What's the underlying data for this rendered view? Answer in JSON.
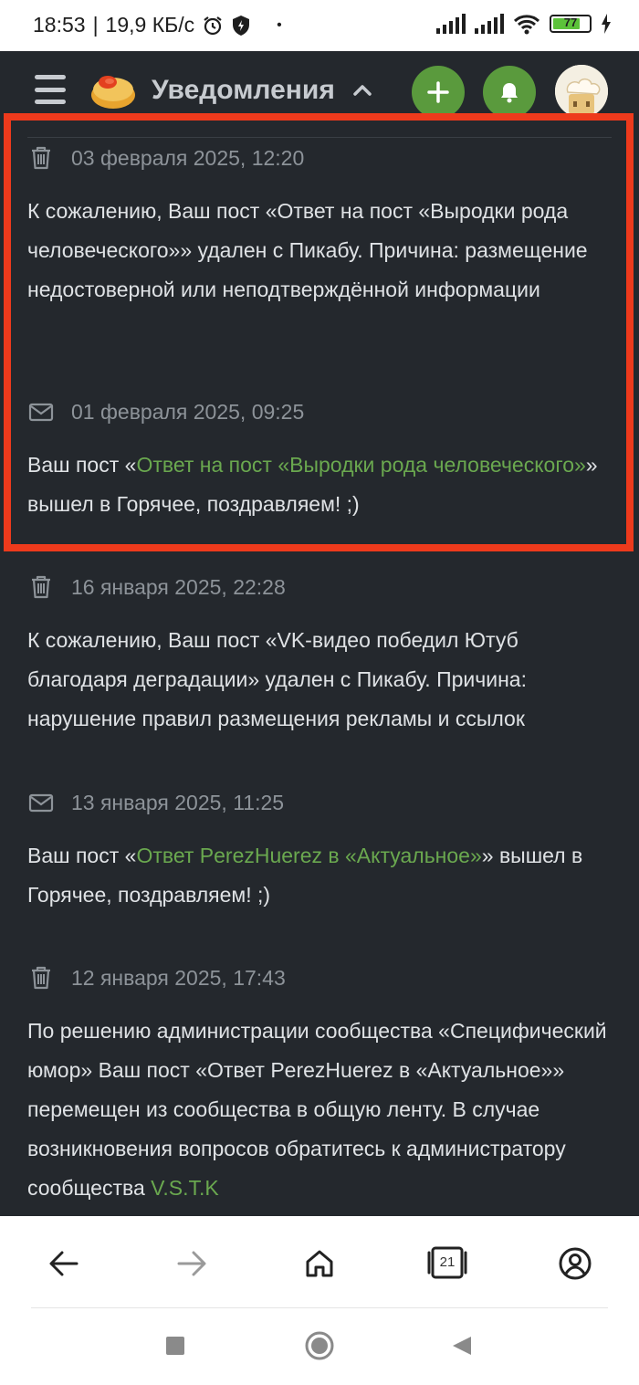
{
  "status_bar": {
    "time": "18:53",
    "network": "19,9 КБ/с",
    "dot": "•",
    "battery": "77",
    "icons": [
      "alarm-icon",
      "shield-icon",
      "signal-icon",
      "signal-icon",
      "wifi-icon",
      "battery-icon",
      "charging-icon"
    ]
  },
  "header": {
    "title": "Уведомления",
    "icons": [
      "menu-icon",
      "pikabu-logo",
      "chevron-up-icon",
      "plus-icon",
      "bell-icon",
      "avatar"
    ]
  },
  "notifications": [
    {
      "icon": "trash-icon",
      "date": "03 февраля 2025, 12:20",
      "text": "К сожалению, Ваш пост «Ответ на пост «Выродки рода человеческого»» удален с Пикабу. Причина: размещение недостоверной или неподтверждённой информации"
    },
    {
      "icon": "mail-icon",
      "date": "01 февраля 2025, 09:25",
      "prefix": "Ваш пост «",
      "link": "Ответ на пост «Выродки рода человеческого»",
      "suffix": "» вышел в Горячее, поздравляем! ;)"
    },
    {
      "icon": "trash-icon",
      "date": "16 января 2025, 22:28",
      "text": "К сожалению, Ваш пост «VK-видео победил Ютуб благодаря деградации» удален с Пикабу. Причина: нарушение правил размещения рекламы и ссылок"
    },
    {
      "icon": "mail-icon",
      "date": "13 января 2025, 11:25",
      "prefix": "Ваш пост «",
      "link": "Ответ PerezHuerez в «Актуальное»",
      "suffix": "» вышел в Горячее, поздравляем! ;)"
    },
    {
      "icon": "trash-icon",
      "date": "12 января 2025, 17:43",
      "text": "По решению администрации сообщества «Специфический юмор» Ваш пост «Ответ PerezHuerez в «Актуальное»» перемещен из сообщества в общую ленту. В случае возникновения вопросов обратитесь к администратору сообщества ",
      "link": "V.S.T.K"
    }
  ],
  "browser_nav": {
    "tab_count": "21",
    "icons": [
      "back-arrow-icon",
      "forward-arrow-icon",
      "home-icon",
      "tabs-icon",
      "profile-icon"
    ]
  },
  "system_nav": {
    "icons": [
      "recents-square-icon",
      "home-circle-icon",
      "back-triangle-icon"
    ]
  },
  "colors": {
    "background": "#24282d",
    "link": "#6aa84f",
    "highlight_border": "#ee3a1c",
    "accent_button": "#5a9a3d"
  }
}
